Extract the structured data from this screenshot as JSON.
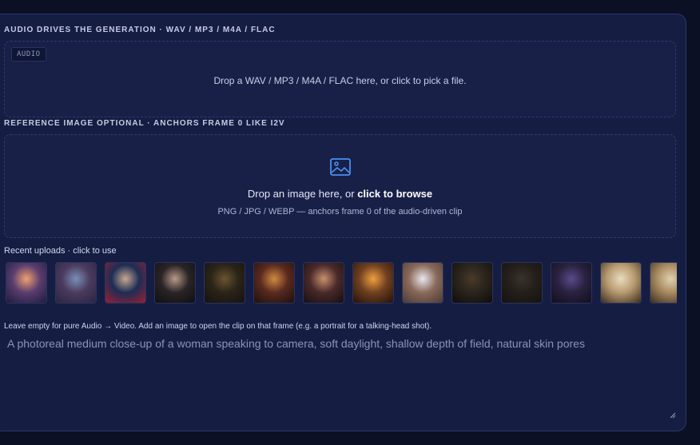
{
  "audio_section": {
    "label": "AUDIO DRIVES THE GENERATION · WAV / MP3 / M4A / FLAC",
    "tag": "AUDIO",
    "hint": "Drop a WAV / MP3 / M4A / FLAC here, or click to pick a file."
  },
  "image_section": {
    "label": "REFERENCE IMAGE OPTIONAL · ANCHORS FRAME 0 LIKE I2V",
    "title_prefix": "Drop an image here, or ",
    "title_action": "click to browse",
    "subtitle": "PNG / JPG / WEBP — anchors frame 0 of the audio-driven clip",
    "icon": "image-icon"
  },
  "recent": {
    "label": "Recent uploads · click to use",
    "thumbnails": [
      {
        "name": "thumb-fantasy-landscape",
        "colors": [
          "#f0a070",
          "#5a3d6e",
          "#1e1c3c"
        ]
      },
      {
        "name": "thumb-fairy-figure",
        "colors": [
          "#7a8fb8",
          "#4b3b5e",
          "#2a2440"
        ]
      },
      {
        "name": "thumb-man-suit-red-tie",
        "colors": [
          "#c8a890",
          "#1d2d55",
          "#9a2030"
        ]
      },
      {
        "name": "thumb-man-portrait-dark",
        "colors": [
          "#b89a88",
          "#2a2426",
          "#0f0f12"
        ]
      },
      {
        "name": "thumb-steampunk-skull",
        "colors": [
          "#6a5430",
          "#2b2418",
          "#141210"
        ]
      },
      {
        "name": "thumb-candle-dinner",
        "colors": [
          "#d08a40",
          "#5a2a20",
          "#1c100c"
        ]
      },
      {
        "name": "thumb-woman-portrait",
        "colors": [
          "#c8906c",
          "#4a2a2a",
          "#160e10"
        ]
      },
      {
        "name": "thumb-fire-battle",
        "colors": [
          "#f0a040",
          "#704020",
          "#241008"
        ]
      },
      {
        "name": "thumb-chef-kitchen",
        "colors": [
          "#e8e8ee",
          "#8a6a5a",
          "#4a3a36"
        ]
      },
      {
        "name": "thumb-dark-control-panel",
        "colors": [
          "#4a3a2a",
          "#2a241c",
          "#0e0c0a"
        ]
      },
      {
        "name": "thumb-dark-shelves",
        "colors": [
          "#3a332c",
          "#241f1a",
          "#141210"
        ]
      },
      {
        "name": "thumb-werewolf-moon",
        "colors": [
          "#5a4a8a",
          "#2a2240",
          "#120e1c"
        ]
      },
      {
        "name": "thumb-vintage-card",
        "colors": [
          "#e8dcc0",
          "#b89a70",
          "#3a2c20"
        ]
      },
      {
        "name": "thumb-vintage-card-2",
        "colors": [
          "#e0d0b0",
          "#a88a60",
          "#3a2c20"
        ]
      }
    ]
  },
  "prompt": {
    "help": "Leave empty for pure Audio → Video. Add an image to open the clip on that frame (e.g. a portrait for a talking-head shot).",
    "placeholder": "A photoreal medium close-up of a woman speaking to camera, soft daylight, shallow depth of field, natural skin pores"
  },
  "colors": {
    "accent": "#4a8ff0",
    "panel_bg": "#161d43",
    "page_bg": "#0b1024"
  }
}
